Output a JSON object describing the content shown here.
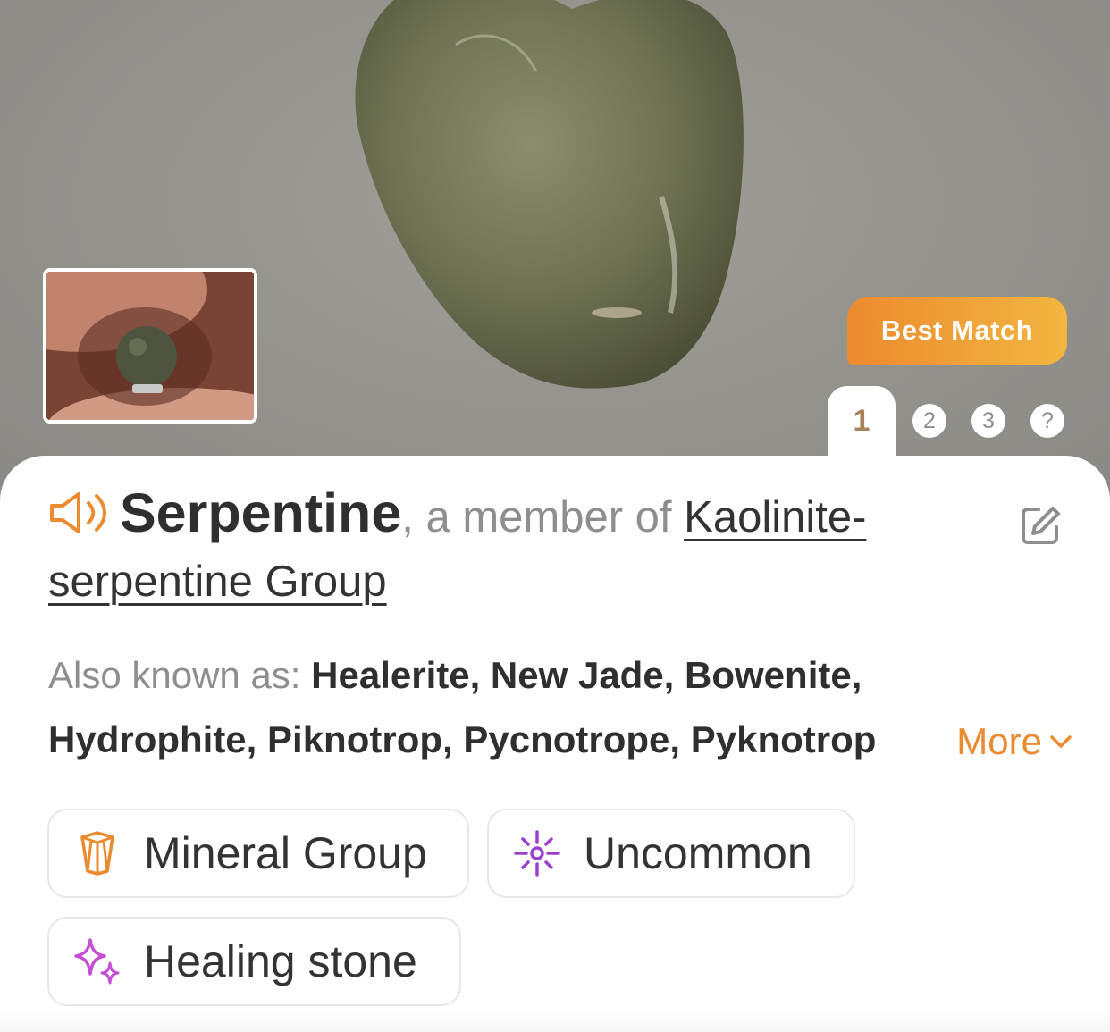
{
  "hero": {
    "badge_label": "Best Match"
  },
  "pager": {
    "pages": [
      "1",
      "2",
      "3",
      "?"
    ],
    "active_index": 0
  },
  "species": {
    "name": "Serpentine",
    "member_prefix": ", a member of ",
    "group_name": "Kaolinite-serpentine Group"
  },
  "aka": {
    "label": "Also known as: ",
    "names_text": "Healerite, New Jade, Bowenite, Hydrophite, Piknotrop, Pycnotrope, Pyknotrop",
    "more_label": "More"
  },
  "tags": [
    {
      "label": "Mineral Group",
      "icon": "crystal-icon",
      "color": "#ec8a2f"
    },
    {
      "label": "Uncommon",
      "icon": "sparkle-burst-icon",
      "color": "#9b3fd1"
    },
    {
      "label": "Healing stone",
      "icon": "sparkles-icon",
      "color": "#c44fd4"
    }
  ],
  "colors": {
    "accent": "#ec8a2f",
    "title": "#2f2f2f",
    "muted": "#8e8e8e"
  }
}
